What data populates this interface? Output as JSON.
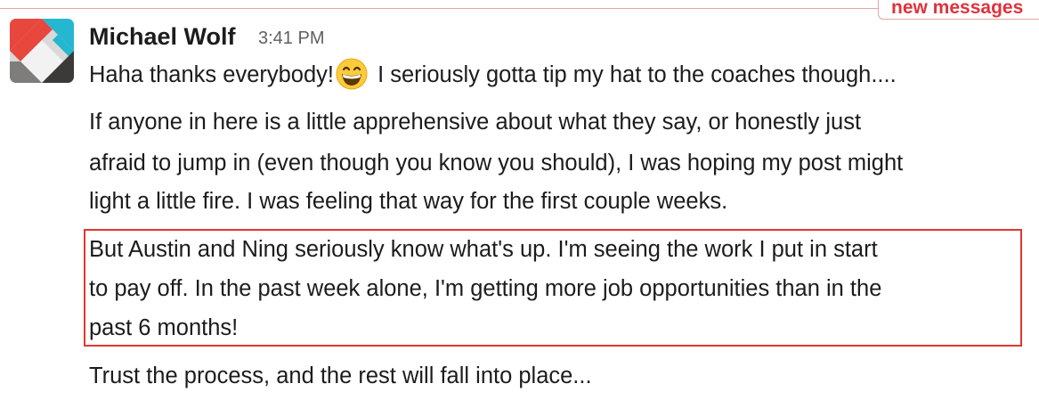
{
  "divider": {
    "label": "new messages"
  },
  "message": {
    "author": "Michael Wolf",
    "time": "3:41 PM",
    "avatar_icon": "geometric-avatar-icon",
    "emoji_icon": "grinning-face-icon",
    "paragraph1_before": "Haha thanks everybody!",
    "paragraph1_after": " I seriously gotta tip my hat to the coaches though....",
    "paragraph2": [
      "If anyone in here is a little apprehensive about what they say, or honestly just",
      "afraid to jump in (even though you know you should), I was hoping my post might",
      "light a little fire. I was feeling that way for the first couple weeks."
    ],
    "paragraph3": [
      "But Austin and Ning seriously know what's up. I'm seeing the work I put in start",
      "to pay off. In the past week alone, I'm getting more job opportunities than in the",
      "past 6 months!"
    ],
    "paragraph4": "Trust the process, and the rest will fall into place..."
  },
  "colors": {
    "new_messages": "#e0323c",
    "highlight_box": "#e2372c",
    "text": "#1d1c1d",
    "timestamp": "#616061"
  }
}
